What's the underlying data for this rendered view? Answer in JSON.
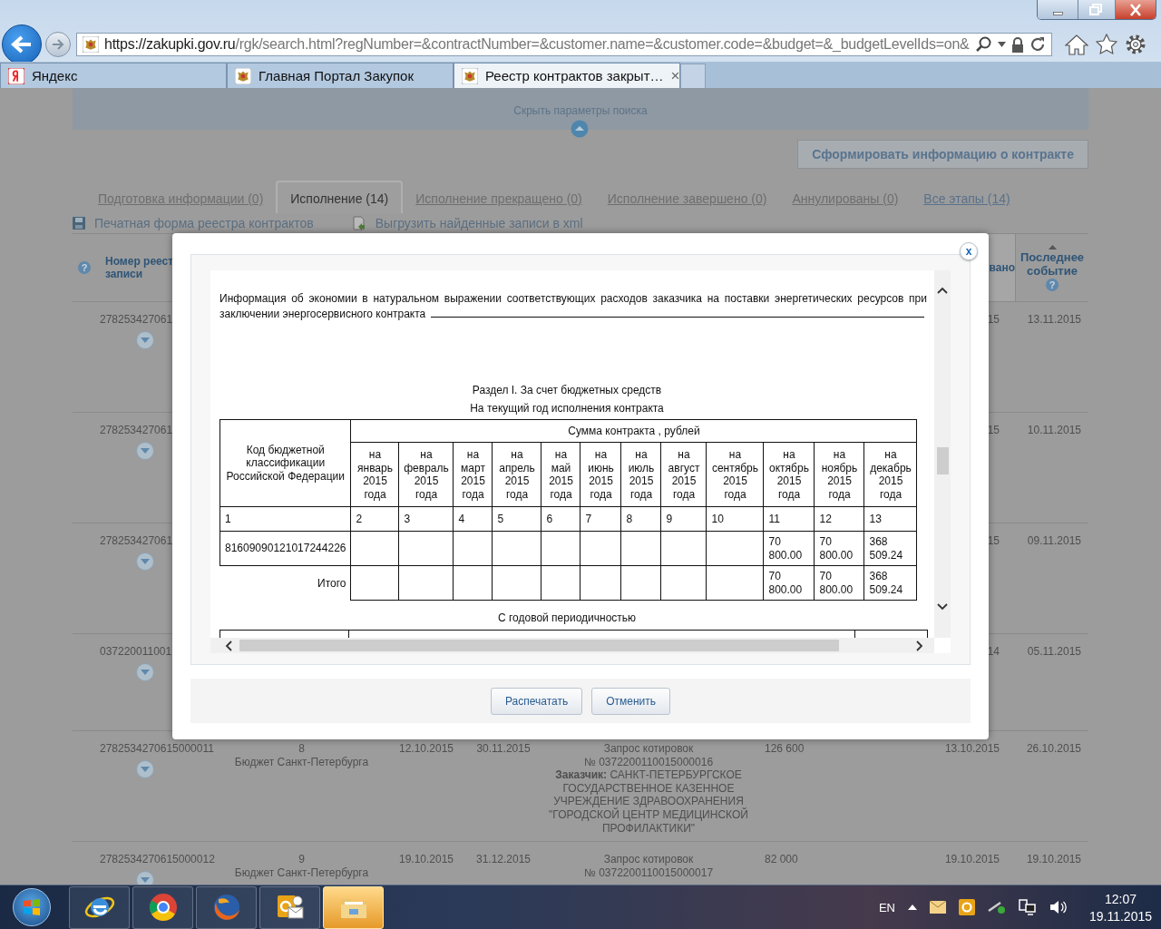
{
  "browser": {
    "window_controls": [
      {
        "kind": "minimize"
      },
      {
        "kind": "maximize"
      },
      {
        "kind": "close"
      }
    ],
    "url": {
      "host": "https://zakupki.gov.ru",
      "path": "/rgk/search.html?regNumber=&contractNumber=&customer.name=&customer.code=&budget=&_budgetLevelIds=on&"
    },
    "tabs": [
      {
        "label": "Яндекс",
        "kind": "yandex",
        "selected": false
      },
      {
        "label": "Главная Портал Закупок",
        "kind": "emblem",
        "selected": false
      },
      {
        "label": "Реестр контрактов закрыт…",
        "kind": "emblem",
        "selected": true,
        "close": "×"
      }
    ]
  },
  "page": {
    "search_toggle": "Скрыть параметры поиска",
    "generate_button": "Сформировать информацию о контракте",
    "tabs": [
      {
        "label": "Подготовка информации (0)",
        "selected": false
      },
      {
        "label": "Исполнение (14)",
        "selected": true
      },
      {
        "label": "Исполнение прекращено (0)",
        "selected": false
      },
      {
        "label": "Исполнение завершено (0)",
        "selected": false
      },
      {
        "label": "Аннулированы (0)",
        "selected": false
      },
      {
        "label": "Все этапы (14)",
        "selected": false
      }
    ],
    "actions": [
      {
        "kind": "print",
        "label": "Печатная форма реестра контрактов"
      },
      {
        "kind": "xml",
        "label": "Выгрузить найденные записи в xml"
      }
    ],
    "table": {
      "help": "?",
      "columns": [
        {
          "lines": [
            "Номер реест",
            "записи"
          ]
        },
        {
          "lines": [
            "вано"
          ]
        },
        {
          "lines": [
            "Последнее",
            "событие"
          ],
          "help": "?"
        }
      ],
      "rows": [
        {
          "number": "278253427061",
          "date": "15",
          "last_event": "13.11.2015"
        },
        {
          "number": "278253427061",
          "date": "15",
          "last_event": "10.11.2015"
        },
        {
          "number": "278253427061",
          "date": "15",
          "last_event": "09.11.2015"
        },
        {
          "number": "037220011001",
          "date": "14",
          "last_event": "05.11.2015"
        },
        {
          "number": "2782534270615000011",
          "stage": "8",
          "budget": "Бюджет Санкт-Петербурга",
          "start": "12.10.2015",
          "end": "30.11.2015",
          "procedure": "Запрос котировок",
          "notice": "№ 0372200110015000016",
          "customer": "**Заказчик:** САНКТ-ПЕТЕРБУРГСКОЕ ГОСУДАРСТВЕННОЕ КАЗЕННОЕ УЧРЕЖДЕНИЕ ЗДРАВООХРАНЕНИЯ \"ГОРОДСКОЙ ЦЕНТР МЕДИЦИНСКОЙ ПРОФИЛАКТИКИ\"",
          "price": "126 600",
          "date": "13.10.2015",
          "last_event": "26.10.2015"
        },
        {
          "number": "2782534270615000012",
          "stage": "9",
          "budget": "Бюджет Санкт-Петербурга",
          "start": "19.10.2015",
          "end": "31.12.2015",
          "procedure": "Запрос котировок",
          "notice": "№ 0372200110015000017",
          "price": "82 000",
          "date": "19.10.2015",
          "last_event": "19.10.2015"
        }
      ]
    }
  },
  "modal": {
    "close": "x",
    "paragraph": "Информация об экономии в натуральном выражении соответствующих расходов заказчика на поставки энергетических ресурсов при заключении энергосервисного контракта",
    "section_title": "Раздел I. За счет бюджетных средств",
    "subtitle": "На текущий год исполнения контракта",
    "table": {
      "code_header": "Код бюджетной классификации Российской Федерации",
      "sum_header": "Сумма контракта , рублей",
      "months": [
        "на январь 2015 года",
        "на февраль 2015 года",
        "на март 2015 года",
        "на апрель 2015 года",
        "на май 2015 года",
        "на июнь 2015 года",
        "на июль 2015 года",
        "на август 2015 года",
        "на сентябрь 2015 года",
        "на октябрь 2015 года",
        "на ноябрь 2015 года",
        "на декабрь 2015 года"
      ],
      "numbers": [
        "1",
        "2",
        "3",
        "4",
        "5",
        "6",
        "7",
        "8",
        "9",
        "10",
        "11",
        "12",
        "13"
      ],
      "rows": [
        {
          "kind": "code",
          "label": "81609090121017244226",
          "values": [
            "70 800.00",
            "70 800.00",
            "368 509.24"
          ]
        },
        {
          "kind": "total",
          "label": "Итого",
          "values": [
            "70 800.00",
            "70 800.00",
            "368 509.24"
          ]
        }
      ]
    },
    "next_heading": "С годовой периодичностью",
    "buttons": [
      "Распечатать",
      "Отменить"
    ]
  },
  "taskbar": {
    "apps": [
      {
        "kind": "ie",
        "selected": false
      },
      {
        "kind": "chrome",
        "selected": false
      },
      {
        "kind": "firefox",
        "selected": false
      },
      {
        "kind": "outlook",
        "selected": false
      },
      {
        "kind": "explorer",
        "selected": true
      }
    ],
    "language": "EN",
    "time": "12:07",
    "date": "19.11.2015"
  }
}
